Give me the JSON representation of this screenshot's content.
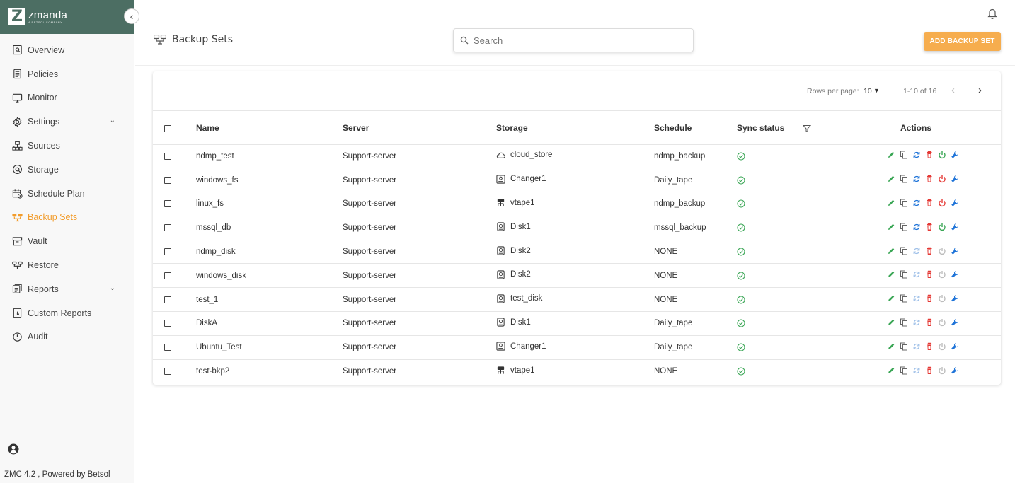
{
  "brand": {
    "name": "zmanda",
    "tagline": "A BETSOL COMPANY"
  },
  "nav": [
    {
      "id": "overview",
      "label": "Overview",
      "icon": "overview-icon",
      "chevron": false,
      "active": false
    },
    {
      "id": "policies",
      "label": "Policies",
      "icon": "policies-icon",
      "chevron": false,
      "active": false
    },
    {
      "id": "monitor",
      "label": "Monitor",
      "icon": "monitor-icon",
      "chevron": false,
      "active": false
    },
    {
      "id": "settings",
      "label": "Settings",
      "icon": "gear-icon",
      "chevron": true,
      "active": false
    },
    {
      "id": "sources",
      "label": "Sources",
      "icon": "sources-icon",
      "chevron": false,
      "active": false
    },
    {
      "id": "storage",
      "label": "Storage",
      "icon": "storage-icon",
      "chevron": false,
      "active": false
    },
    {
      "id": "schedule-plan",
      "label": "Schedule Plan",
      "icon": "calendar-icon",
      "chevron": false,
      "active": false
    },
    {
      "id": "backup-sets",
      "label": "Backup Sets",
      "icon": "backup-sets-icon",
      "chevron": false,
      "active": true
    },
    {
      "id": "vault",
      "label": "Vault",
      "icon": "vault-icon",
      "chevron": false,
      "active": false
    },
    {
      "id": "restore",
      "label": "Restore",
      "icon": "restore-icon",
      "chevron": false,
      "active": false
    },
    {
      "id": "reports",
      "label": "Reports",
      "icon": "reports-icon",
      "chevron": true,
      "active": false
    },
    {
      "id": "custom-reports",
      "label": "Custom Reports",
      "icon": "custom-reports-icon",
      "chevron": false,
      "active": false
    },
    {
      "id": "audit",
      "label": "Audit",
      "icon": "audit-icon",
      "chevron": false,
      "active": false
    }
  ],
  "footer": "ZMC 4.2 , Powered by Betsol",
  "header": {
    "title": "Backup Sets",
    "search_placeholder": "Search",
    "add_button": "ADD BACKUP SET"
  },
  "pager": {
    "rows_per_page_label": "Rows per page:",
    "rows_per_page_value": "10",
    "range": "1-10 of 16"
  },
  "columns": {
    "name": "Name",
    "server": "Server",
    "storage": "Storage",
    "schedule": "Schedule",
    "sync": "Sync status",
    "actions": "Actions"
  },
  "colors": {
    "accent": "#f29c2b",
    "brand": "#4c6e63",
    "green": "#3aa655",
    "red": "#e53935",
    "blue": "#1e73d8",
    "disabled": "#bdbdbd"
  },
  "rows": [
    {
      "name": "ndmp_test",
      "server": "Support-server",
      "storage": "cloud_store",
      "storage_icon": "cloud-icon",
      "schedule": "ndmp_backup",
      "power": "green"
    },
    {
      "name": "windows_fs",
      "server": "Support-server",
      "storage": "Changer1",
      "storage_icon": "changer-icon",
      "schedule": "Daily_tape",
      "power": "red"
    },
    {
      "name": "linux_fs",
      "server": "Support-server",
      "storage": "vtape1",
      "storage_icon": "vtape-icon",
      "schedule": "ndmp_backup",
      "power": "red"
    },
    {
      "name": "mssql_db",
      "server": "Support-server",
      "storage": "Disk1",
      "storage_icon": "disk-icon",
      "schedule": "mssql_backup",
      "power": "green"
    },
    {
      "name": "ndmp_disk",
      "server": "Support-server",
      "storage": "Disk2",
      "storage_icon": "disk-icon",
      "schedule": "NONE",
      "power": "disabled"
    },
    {
      "name": "windows_disk",
      "server": "Support-server",
      "storage": "Disk2",
      "storage_icon": "disk-icon",
      "schedule": "NONE",
      "power": "disabled"
    },
    {
      "name": "test_1",
      "server": "Support-server",
      "storage": "test_disk",
      "storage_icon": "disk-icon",
      "schedule": "NONE",
      "power": "disabled"
    },
    {
      "name": "DiskA",
      "server": "Support-server",
      "storage": "Disk1",
      "storage_icon": "disk-icon",
      "schedule": "Daily_tape",
      "power": "disabled"
    },
    {
      "name": "Ubuntu_Test",
      "server": "Support-server",
      "storage": "Changer1",
      "storage_icon": "changer-icon",
      "schedule": "Daily_tape",
      "power": "disabled"
    },
    {
      "name": "test-bkp2",
      "server": "Support-server",
      "storage": "vtape1",
      "storage_icon": "vtape-icon",
      "schedule": "NONE",
      "power": "disabled"
    }
  ]
}
